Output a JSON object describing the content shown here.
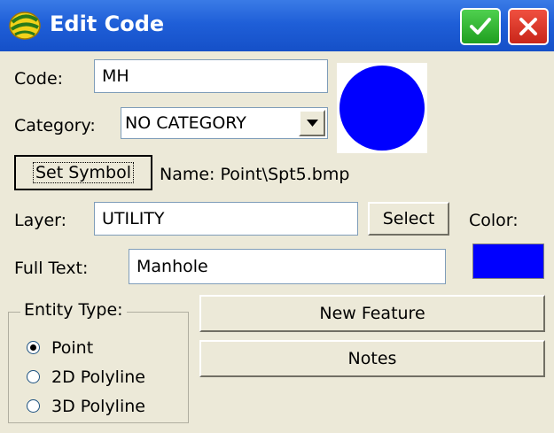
{
  "window": {
    "title": "Edit Code",
    "ok_icon": "checkmark-icon",
    "close_icon": "close-icon",
    "app_icon": "carlson-logo-icon",
    "titlebar_color": "#1f5fd8"
  },
  "code": {
    "label": "Code:",
    "value": "MH"
  },
  "category": {
    "label": "Category:",
    "value": "NO CATEGORY",
    "dropdown_icon": "chevron-down-icon"
  },
  "symbol": {
    "button_label": "Set Symbol",
    "name_text": "Name: Point\\Spt5.bmp",
    "preview_color": "#0000ff"
  },
  "layer": {
    "label": "Layer:",
    "value": "UTILITY",
    "select_label": "Select"
  },
  "color": {
    "label": "Color:",
    "value": "#0000ff"
  },
  "full_text": {
    "label": "Full Text:",
    "value": "Manhole"
  },
  "entity_type": {
    "title": "Entity Type:",
    "options": [
      {
        "label": "Point",
        "checked": true
      },
      {
        "label": "2D Polyline",
        "checked": false
      },
      {
        "label": "3D Polyline",
        "checked": false
      }
    ]
  },
  "actions": {
    "new_feature": "New Feature",
    "notes": "Notes"
  }
}
